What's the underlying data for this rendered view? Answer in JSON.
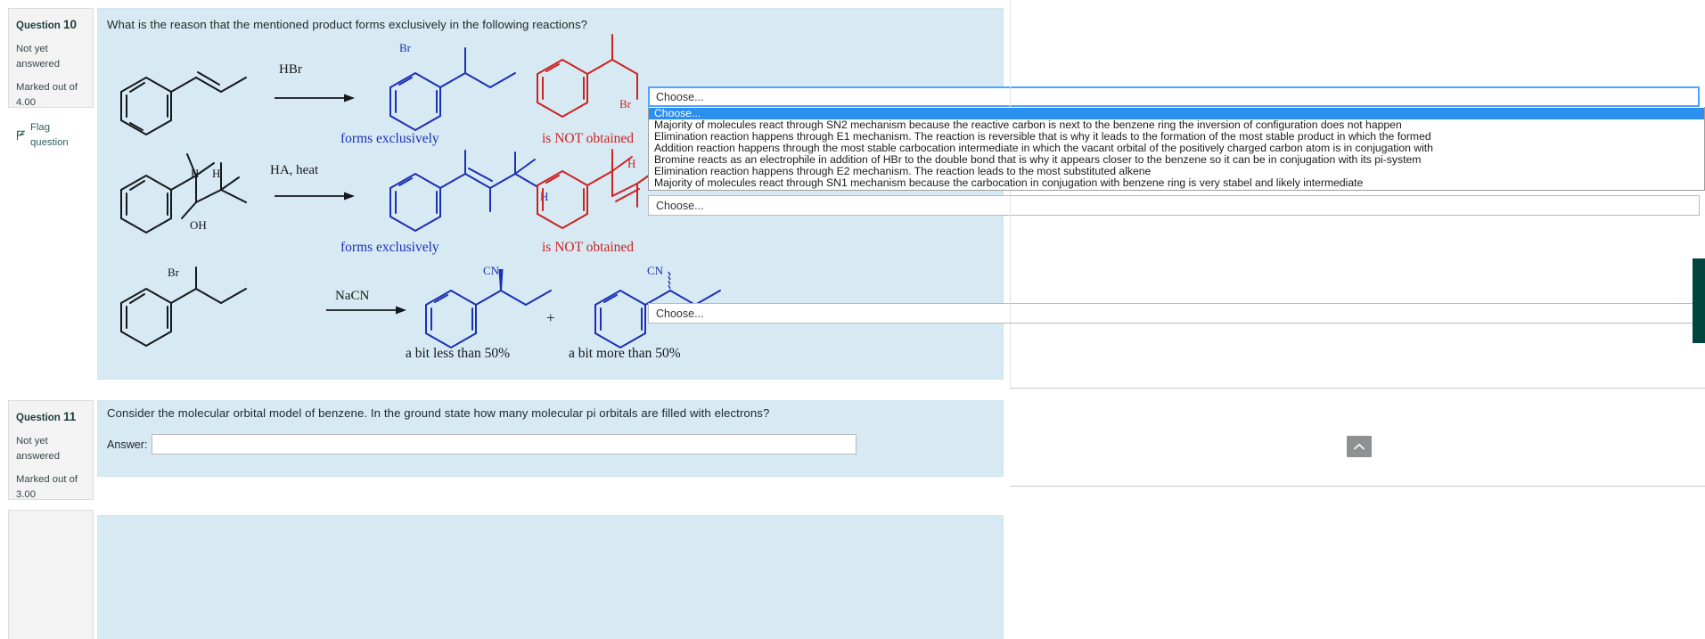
{
  "questions": [
    {
      "label": "Question",
      "number": "10",
      "status": "Not yet answered",
      "marked_label": "Marked out of",
      "marked_value": "4.00",
      "flag": "Flag question",
      "prompt": "What is the reason that the mentioned product forms exclusively in the following reactions?"
    },
    {
      "label": "Question",
      "number": "11",
      "status": "Not yet answered",
      "marked_label": "Marked out of",
      "marked_value": "3.00",
      "flag": "Flag question",
      "prompt": "Consider the molecular orbital model of benzene. In the ground state how many molecular pi orbitals are filled with electrons?",
      "answer_label": "Answer:",
      "answer_value": "",
      "answer_placeholder": ""
    }
  ],
  "reactions": [
    {
      "reagent": "HBr",
      "product_caption": "forms exclusively",
      "byproduct_caption": "is NOT obtained",
      "product_label": "Br",
      "byproduct_label": "Br"
    },
    {
      "reagent": "HA, heat",
      "product_caption": "forms exclusively",
      "byproduct_caption": "is NOT obtained",
      "product_label_h1": "H",
      "reactant_label_h1": "H",
      "reactant_label_h2": "H",
      "reactant_label_oh": "OH",
      "byproduct_label_h": "H"
    },
    {
      "reagent": "NaCN",
      "reactant_label": "Br",
      "plus": "+",
      "product_label_cn": "CN",
      "product2_label_cn": "CN",
      "caption_left": "a bit less than 50%",
      "caption_right": "a bit more than 50%"
    }
  ],
  "selects": [
    {
      "value": "Choose...",
      "open": true
    },
    {
      "value": "Choose...",
      "open": false
    },
    {
      "value": "Choose...",
      "open": false
    }
  ],
  "dropdown": {
    "options": [
      "Choose...",
      "Majority of molecules react through SN2 mechanism because the reactive carbon is next to the benzene ring the inversion of configuration does not happen",
      "Elimination reaction happens through E1 mechanism. The reaction is reversible that is why it leads to the formation of the most stable product in which the formed",
      "Addition reaction happens through the most stable carbocation intermediate in which the vacant orbital of the positively charged carbon atom is in conjugation with",
      "Bromine reacts as an electrophile in addition of HBr to the double bond that is why it appears closer to the benzene so it can be in conjugation with its pi-system",
      "Elimination reaction happens through E2 mechanism. The reaction leads to the most substituted alkene",
      "Majority of molecules react through SN1 mechanism because the carbocation in conjugation with benzene ring is very stabel and likely intermediate"
    ],
    "selected_index": 0
  },
  "chrome": {
    "scroll_top_icon": "chevron-up-icon",
    "side_tab": "side-tab"
  },
  "colors": {
    "question_bg": "#d7eaf3",
    "info_bg": "#f3f3f3",
    "product_blue": "#1a2fb5",
    "byproduct_red": "#cc2222",
    "highlight_blue": "#2a8fef",
    "side_tab": "#02453f"
  }
}
